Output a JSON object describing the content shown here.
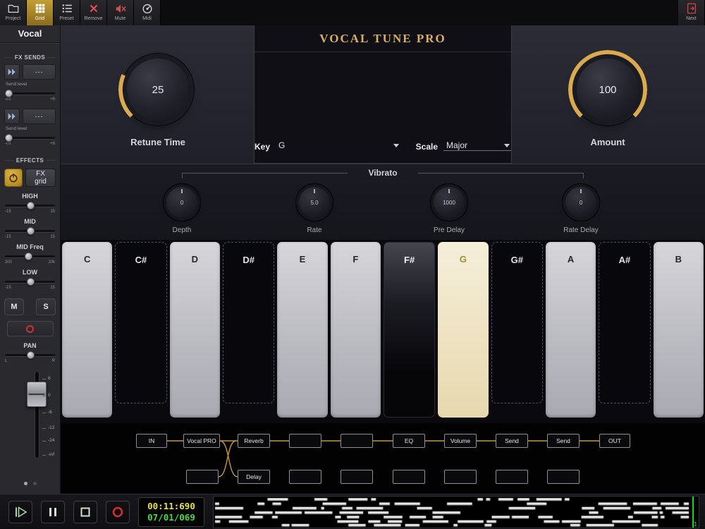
{
  "toolbar": {
    "project": {
      "label": "Project"
    },
    "grid": {
      "label": "Grid"
    },
    "preset": {
      "label": "Preset"
    },
    "remove": {
      "label": "Remove"
    },
    "mute": {
      "label": "Mute"
    },
    "midi": {
      "label": "Midi"
    },
    "next": {
      "label": "Next"
    }
  },
  "sidebar": {
    "track_name": "Vocal",
    "fx_sends_header": "FX SENDS",
    "send1": {
      "value": "---",
      "level_label": "Send level",
      "min": "-inf",
      "max": "+6"
    },
    "send2": {
      "value": "---",
      "level_label": "Send level",
      "min": "-inf",
      "max": "+6"
    },
    "effects_header": "EFFECTS",
    "fx_grid_label": "FX grid",
    "eq_high": {
      "label": "HIGH",
      "min": "-15",
      "max": "15"
    },
    "eq_mid": {
      "label": "MID",
      "min": "-15",
      "max": "15"
    },
    "eq_midfreq": {
      "label": "MID Freq",
      "min": "300",
      "max": "20k"
    },
    "eq_low": {
      "label": "LOW",
      "min": "-15",
      "max": "15"
    },
    "mute_label": "M",
    "solo_label": "S",
    "pan_label": "PAN",
    "pan_min": "L",
    "pan_max": "R",
    "fader_ticks": [
      "6",
      "0",
      "-6",
      "-12",
      "-24",
      "-inf"
    ]
  },
  "plugin": {
    "title": "VOCAL TUNE PRO",
    "key_label": "Key",
    "key_value": "G",
    "scale_label": "Scale",
    "scale_value": "Major",
    "current_note": "G",
    "retune_knob": {
      "value": "25",
      "label": "Retune Time"
    },
    "amount_knob": {
      "value": "100",
      "label": "Amount"
    },
    "vibrato_title": "Vibrato",
    "vibrato_knobs": [
      {
        "value": "0",
        "label": "Depth"
      },
      {
        "value": "5.0",
        "label": "Rate"
      },
      {
        "value": "1000",
        "label": "Pre Delay"
      },
      {
        "value": "0",
        "label": "Rate Delay"
      }
    ],
    "keys": [
      {
        "note": "C",
        "type": "white"
      },
      {
        "note": "C#",
        "type": "black"
      },
      {
        "note": "D",
        "type": "white"
      },
      {
        "note": "D#",
        "type": "black"
      },
      {
        "note": "E",
        "type": "white"
      },
      {
        "note": "F",
        "type": "white"
      },
      {
        "note": "F#",
        "type": "pressed"
      },
      {
        "note": "G",
        "type": "selected"
      },
      {
        "note": "G#",
        "type": "black"
      },
      {
        "note": "A",
        "type": "white"
      },
      {
        "note": "A#",
        "type": "black"
      },
      {
        "note": "B",
        "type": "white"
      }
    ],
    "accent_color": "#d9aa4f"
  },
  "fx_chain": {
    "row1": [
      "IN",
      "Vocal PRO",
      "Reverb",
      "",
      "",
      "EQ",
      "Volume",
      "Send",
      "Send",
      "OUT"
    ],
    "row2": [
      "",
      "Delay",
      "",
      "",
      "",
      "",
      "",
      ""
    ]
  },
  "transport": {
    "time_main": "00:11:690",
    "time_bars": "07/01/069",
    "playhead_label": "1"
  }
}
